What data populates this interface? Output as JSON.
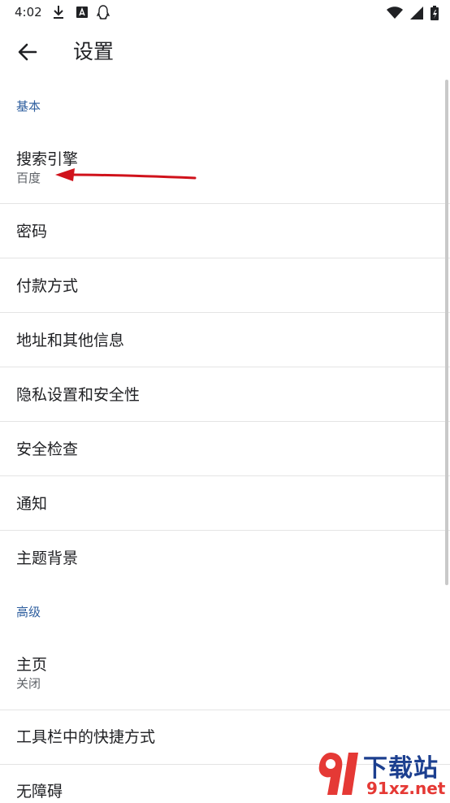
{
  "status_bar": {
    "time": "4:02"
  },
  "app_bar": {
    "title": "设置"
  },
  "sections": {
    "basic": "基本",
    "advanced": "高级"
  },
  "items": {
    "search_engine": {
      "title": "搜索引擎",
      "value": "百度"
    },
    "passwords": {
      "title": "密码"
    },
    "payment": {
      "title": "付款方式"
    },
    "address": {
      "title": "地址和其他信息"
    },
    "privacy": {
      "title": "隐私设置和安全性"
    },
    "safety_check": {
      "title": "安全检查"
    },
    "notifications": {
      "title": "通知"
    },
    "themes": {
      "title": "主题背景"
    },
    "homepage": {
      "title": "主页",
      "value": "关闭"
    },
    "toolbar_shortcut": {
      "title": "工具栏中的快捷方式"
    },
    "accessibility": {
      "title": "无障碍"
    }
  },
  "watermark": {
    "brand": "下载站",
    "site": "91xz.net"
  },
  "colors": {
    "section_header": "#2f5f9f",
    "arrow": "#d0121b",
    "divider": "#e4e4e4"
  }
}
